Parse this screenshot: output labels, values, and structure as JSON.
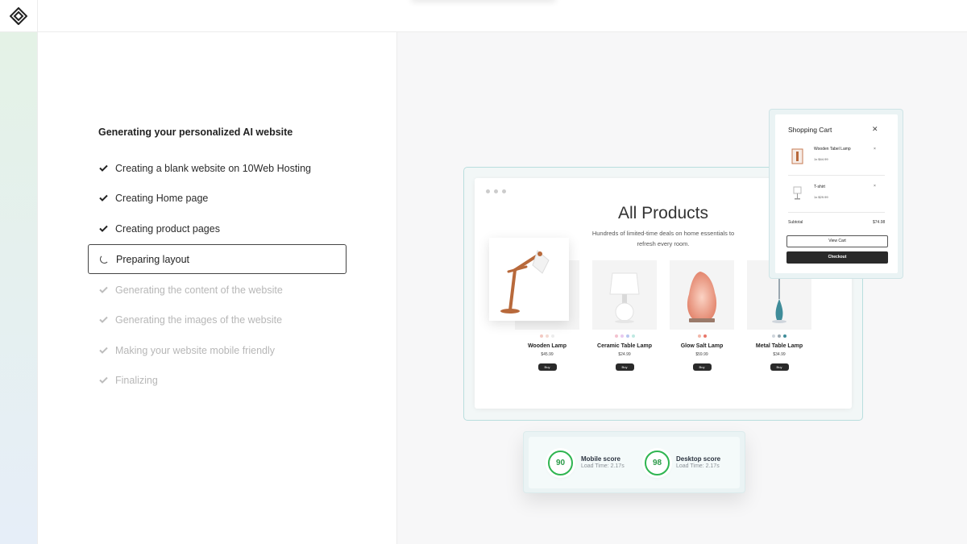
{
  "app": {
    "logo_icon": "diamond-logo-icon"
  },
  "progress": {
    "title": "Generating your personalized AI website",
    "steps": [
      {
        "label": "Creating a blank website on 10Web Hosting",
        "status": "done"
      },
      {
        "label": "Creating Home page",
        "status": "done"
      },
      {
        "label": "Creating product pages",
        "status": "done"
      },
      {
        "label": "Preparing layout",
        "status": "active"
      },
      {
        "label": "Generating the content of the website",
        "status": "pending"
      },
      {
        "label": "Generating the images of the website",
        "status": "pending"
      },
      {
        "label": "Making your website mobile friendly",
        "status": "pending"
      },
      {
        "label": "Finalizing",
        "status": "pending"
      }
    ]
  },
  "preview": {
    "heading": "All Products",
    "subheading": "Hundreds of limited-time deals on home essentials to refresh every room.",
    "products": [
      {
        "name": "Wooden Lamp",
        "price": "$45.99",
        "buy": "Buy",
        "swatches": [
          "#f3c9c2",
          "#f4d9d2",
          "#ececec"
        ]
      },
      {
        "name": "Ceramic Table Lamp",
        "price": "$24.99",
        "buy": "Buy",
        "swatches": [
          "#f3c2cf",
          "#e7c9ef",
          "#b8c6f0",
          "#bfe9e2"
        ]
      },
      {
        "name": "Glow Salt Lamp",
        "price": "$59.99",
        "buy": "Buy",
        "swatches": [
          "#f2b7a9",
          "#e8766a"
        ]
      },
      {
        "name": "Metal Table Lamp",
        "price": "$34.99",
        "buy": "Buy",
        "swatches": [
          "#cfd5dc",
          "#9aa7b0",
          "#3f8c99"
        ]
      }
    ]
  },
  "cart": {
    "title": "Shopping Cart",
    "close_icon": "close-icon",
    "items": [
      {
        "name": "Wooden Tabel Lamp",
        "qty_price": "1x $44.99",
        "remove": "×"
      },
      {
        "name": "T-shirt",
        "qty_price": "1x $29.99",
        "remove": "×"
      }
    ],
    "subtotal_label": "Subtotal",
    "subtotal_value": "$74.98",
    "view_cart": "View Cart",
    "checkout": "Checkout"
  },
  "scores": {
    "mobile": {
      "value": "90",
      "label": "Mobile score",
      "load": "Load Time: 2.17s"
    },
    "desktop": {
      "value": "98",
      "label": "Desktop score",
      "load": "Load Time: 2.17s"
    },
    "accent": "#2fb551"
  }
}
